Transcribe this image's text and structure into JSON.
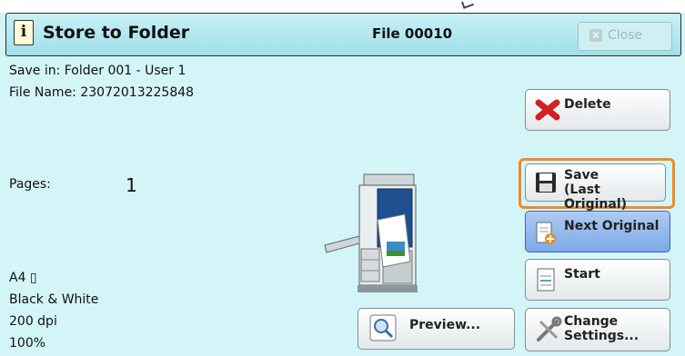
{
  "header": {
    "title": "Store to Folder",
    "file_label": "File 00010",
    "close_label": "Close"
  },
  "info": {
    "save_in": "Save in: Folder 001 - User 1",
    "file_name": "File Name: 23072013225848",
    "pages_label": "Pages:",
    "pages_value": "1",
    "paper": "A4 ▯",
    "color_mode": "Black & White",
    "resolution": "200 dpi",
    "scale": "100%"
  },
  "buttons": {
    "delete": "Delete",
    "save_line1": "Save",
    "save_line2": "(Last Original)",
    "next_original": "Next Original",
    "start": "Start",
    "preview": "Preview...",
    "change_line1": "Change",
    "change_line2": "Settings..."
  },
  "colors": {
    "background": "#d4f5f8",
    "highlight": "#f08a24",
    "selected_button": "#7ea8e8"
  },
  "icons": [
    "info-icon",
    "close-icon",
    "delete-x-icon",
    "save-disk-icon",
    "next-original-icon",
    "start-icon",
    "preview-magnifier-icon",
    "settings-tools-icon",
    "copier-machine-icon"
  ]
}
